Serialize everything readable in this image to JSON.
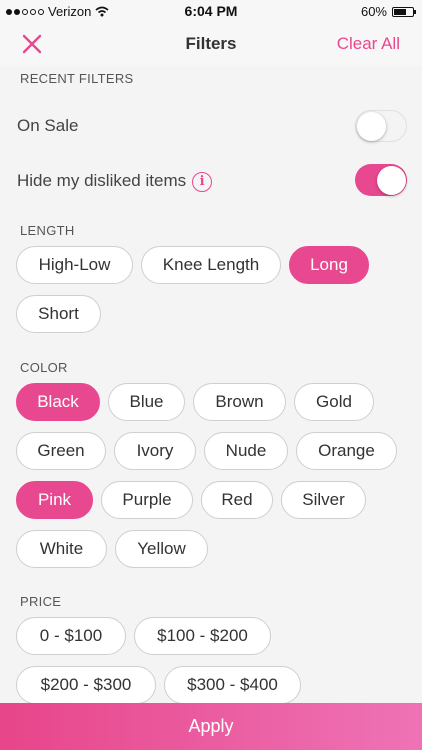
{
  "status_bar": {
    "carrier": "Verizon",
    "time": "6:04 PM",
    "battery": "60%",
    "icons": [
      "signal-dots-icon",
      "wifi-icon",
      "battery-icon"
    ]
  },
  "nav": {
    "title": "Filters",
    "close_icon": "close-icon",
    "clear_all": "Clear All"
  },
  "recent_filters": {
    "header": "RECENT FILTERS",
    "on_sale": {
      "label": "On Sale",
      "enabled": false
    },
    "hide_disliked": {
      "label": "Hide my disliked items",
      "enabled": true,
      "info": "i"
    }
  },
  "length": {
    "header": "LENGTH",
    "options": [
      "High-Low",
      "Knee Length",
      "Long",
      "Short"
    ],
    "selected": [
      "Long"
    ]
  },
  "color": {
    "header": "COLOR",
    "options": [
      "Black",
      "Blue",
      "Brown",
      "Gold",
      "Green",
      "Ivory",
      "Nude",
      "Orange",
      "Pink",
      "Purple",
      "Red",
      "Silver",
      "White",
      "Yellow"
    ],
    "selected": [
      "Black",
      "Pink"
    ]
  },
  "price": {
    "header": "PRICE",
    "options": [
      "0 - $100",
      "$100 - $200",
      "$200 - $300",
      "$300 - $400"
    ],
    "selected": []
  },
  "apply_label": "Apply",
  "colors": {
    "accent": "#e8488f",
    "background": "#f4f4f4"
  }
}
